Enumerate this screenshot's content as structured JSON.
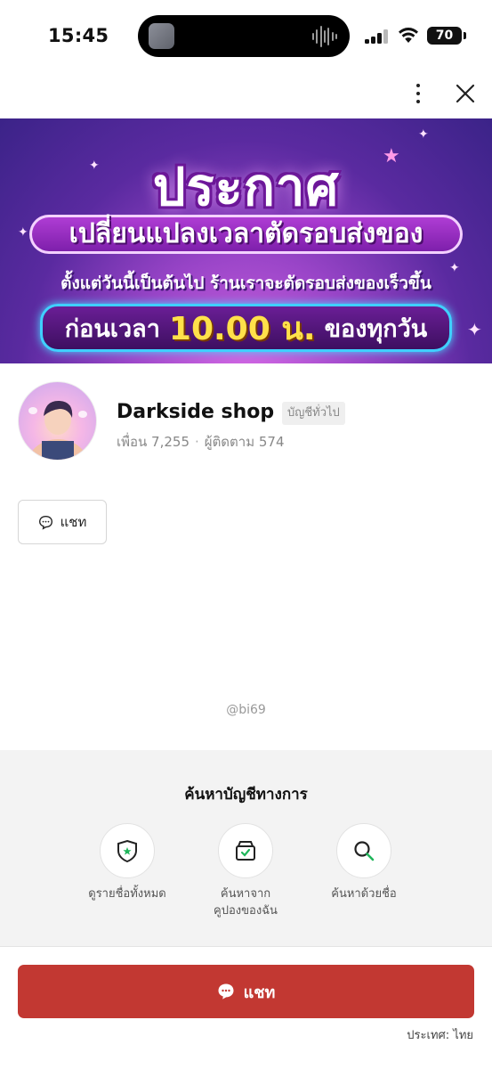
{
  "status_bar": {
    "time": "15:45",
    "battery": "70",
    "icons": [
      "signal-icon",
      "wifi-icon",
      "battery-icon"
    ]
  },
  "toolbar": {
    "more_icon": "more-vertical-icon",
    "close_icon": "close-icon"
  },
  "banner": {
    "title": "ประกาศ",
    "subtitle": "เปลี่ยนแปลงเวลาตัดรอบส่งของ",
    "line": "ตั้งแต่วันนี้เป็นต้นไป ร้านเราจะตัดรอบส่งของเร็วขึ้น",
    "pill_before": "ก่อนเวลา",
    "pill_time": "10.00 น.",
    "pill_after": "ของทุกวัน",
    "colors": {
      "accent": "#ffe14a",
      "frame": "#3fd0ff"
    }
  },
  "profile": {
    "name": "Darkside shop",
    "account_type": "บัญชีทั่วไป",
    "friends": "เพื่อน 7,255",
    "followers": "ผู้ติดตาม 574",
    "handle": "@bi69"
  },
  "actions": {
    "chat_label": "แชท",
    "chat_icon": "chat-bubble-icon"
  },
  "official_search": {
    "title": "ค้นหาบัญชีทางการ",
    "options": [
      {
        "label": "ดูรายชื่อทั้งหมด",
        "icon": "shield-star-icon"
      },
      {
        "label": "ค้นหาจาก\nคูปองของฉัน",
        "icon": "coupon-box-icon"
      },
      {
        "label": "ค้นหาด้วยชื่อ",
        "icon": "search-icon"
      }
    ]
  },
  "footer": {
    "chat_label": "แชท",
    "country": "ประเทศ: ไทย",
    "button_color": "#c23832"
  }
}
